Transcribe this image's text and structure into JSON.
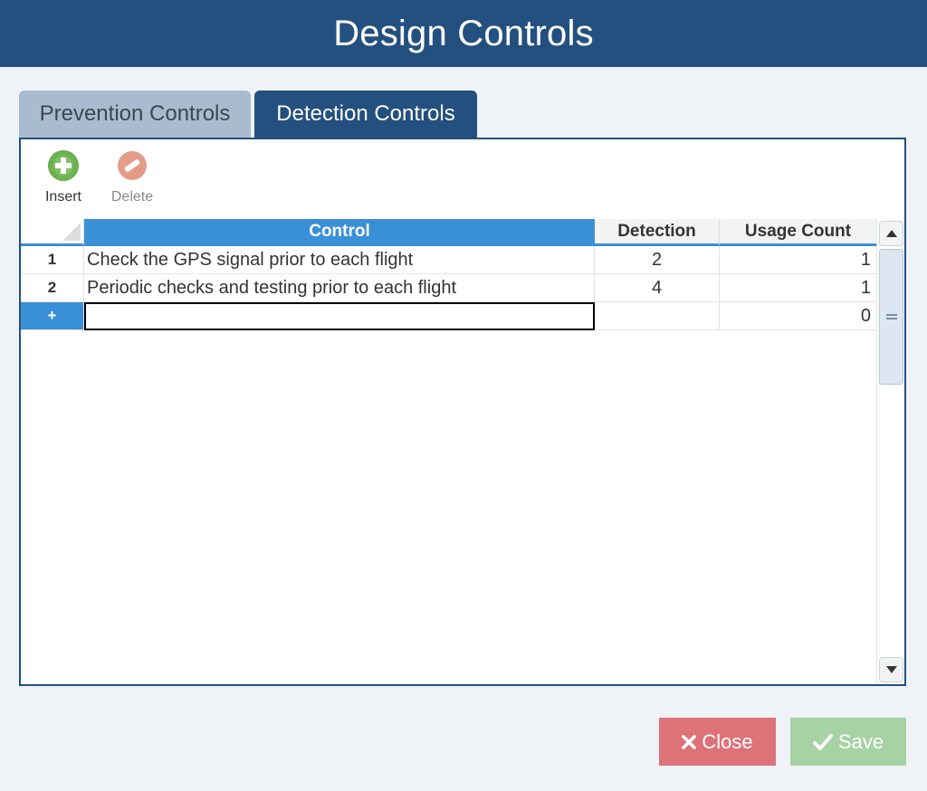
{
  "window": {
    "title": "Design Controls"
  },
  "tabs": [
    {
      "label": "Prevention Controls",
      "active": false
    },
    {
      "label": "Detection Controls",
      "active": true
    }
  ],
  "toolbar": {
    "insert_label": "Insert",
    "insert_icon": "plus-circle-icon",
    "delete_label": "Delete",
    "delete_icon": "minus-circle-icon"
  },
  "grid": {
    "columns": [
      "Control",
      "Detection",
      "Usage Count"
    ],
    "rows": [
      {
        "num": "1",
        "control": "Check the GPS signal prior to each flight",
        "detection": "2",
        "usage": "1"
      },
      {
        "num": "2",
        "control": "Periodic checks and testing prior to each flight",
        "detection": "4",
        "usage": "1"
      }
    ],
    "new_row": {
      "marker": "+",
      "control": "",
      "detection": "",
      "usage": "0"
    }
  },
  "buttons": {
    "close_label": "Close",
    "close_icon": "x-icon",
    "save_label": "Save",
    "save_icon": "check-icon"
  },
  "colors": {
    "header": "#23507f",
    "accent": "#3a90d6",
    "close": "#de7279",
    "save": "#a6d3a3"
  }
}
